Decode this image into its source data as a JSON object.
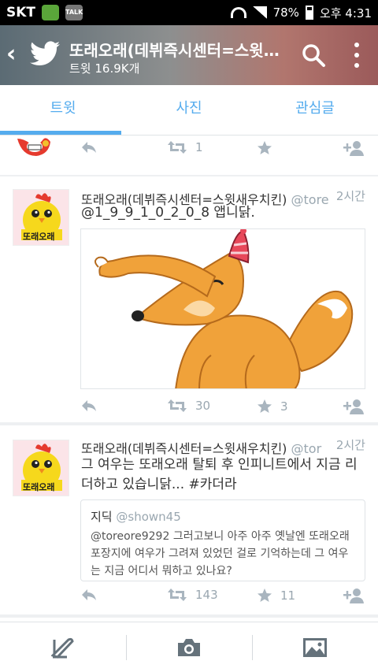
{
  "status_bar": {
    "carrier": "SKT",
    "talk_badge": "TALK",
    "battery": "78%",
    "time": "오후 4:31"
  },
  "header": {
    "title": "또래오래(데뷔즉시센터=스윗새우치킨)",
    "subtitle": "트윗 16.9K개"
  },
  "tabs": [
    {
      "label": "트윗",
      "active": true
    },
    {
      "label": "사진",
      "active": false
    },
    {
      "label": "관심글",
      "active": false
    }
  ],
  "partial_tweet": {
    "retweets": "1",
    "likes": ""
  },
  "tweets": [
    {
      "name": "또래오래(데뷔즉시센터=스윗새우치킨)",
      "handle": "@tore",
      "time": "2시간",
      "text": "@1_9_9_1_0_2_0_8 앱니닭.",
      "retweets": "30",
      "likes": "3"
    },
    {
      "name": "또래오래(데뷔즉시센터=스윗새우치킨)",
      "handle": "@tor",
      "time": "2시간",
      "text": "그 여우는 또래오래 탈퇴 후 인피니트에서 지금 리더하고 있습니닭... #카더라",
      "quote": {
        "name": "지딕",
        "handle": "@shown45",
        "text": "@toreore9292 그러고보니 아주 아주 옛날엔 또래오래 포장지에 여우가 그려져 있었던 걸로 기억하는데 그 여우는 지금 어디서 뭐하고 있나요?"
      },
      "retweets": "143",
      "likes": "11"
    }
  ],
  "avatar_label": "또래오래",
  "bottom_nav": [
    "compose-icon",
    "camera-icon",
    "gallery-icon"
  ],
  "colors": {
    "accent": "#55acee",
    "muted": "#a9b5bf"
  }
}
